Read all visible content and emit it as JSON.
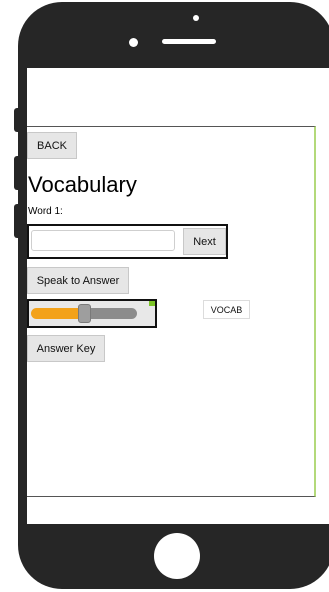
{
  "nav": {
    "back_label": "BACK"
  },
  "page": {
    "title": "Vocabulary"
  },
  "quiz": {
    "word_label": "Word 1:",
    "input_value": "",
    "input_placeholder": "",
    "next_label": "Next"
  },
  "actions": {
    "speak_label": "Speak to Answer",
    "answer_key_label": "Answer Key"
  },
  "slider": {
    "level_fraction": 0.5
  },
  "chip": {
    "label": "VOCAB"
  },
  "colors": {
    "phone_body": "#262626",
    "slider_fill": "#f3a21a",
    "slider_track": "#8c8c8c",
    "frame_accent": "#b3d97a",
    "corner_mark": "#7cc427"
  }
}
